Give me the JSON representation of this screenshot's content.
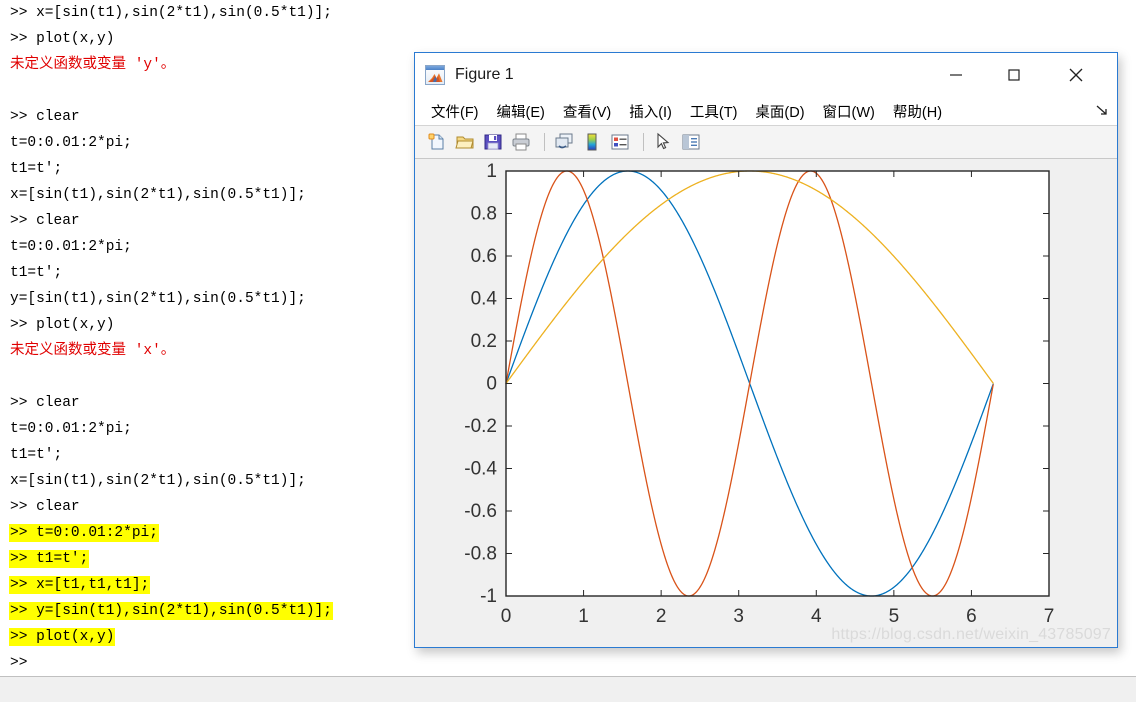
{
  "console": {
    "lines": [
      {
        "text": ">> x=[sin(t1),sin(2*t1),sin(0.5*t1)];",
        "style": "normal",
        "highlight": false
      },
      {
        "text": ">> plot(x,y)",
        "style": "normal",
        "highlight": false
      },
      {
        "text": "未定义函数或变量 'y'。",
        "style": "error",
        "highlight": false
      },
      {
        "text": "",
        "style": "normal",
        "highlight": false
      },
      {
        "text": ">> clear",
        "style": "normal",
        "highlight": false
      },
      {
        "text": "t=0:0.01:2*pi;",
        "style": "normal",
        "highlight": false
      },
      {
        "text": "t1=t';",
        "style": "normal",
        "highlight": false
      },
      {
        "text": "x=[sin(t1),sin(2*t1),sin(0.5*t1)];",
        "style": "normal",
        "highlight": false
      },
      {
        "text": ">> clear",
        "style": "normal",
        "highlight": false
      },
      {
        "text": "t=0:0.01:2*pi;",
        "style": "normal",
        "highlight": false
      },
      {
        "text": "t1=t';",
        "style": "normal",
        "highlight": false
      },
      {
        "text": "y=[sin(t1),sin(2*t1),sin(0.5*t1)];",
        "style": "normal",
        "highlight": false
      },
      {
        "text": ">> plot(x,y)",
        "style": "normal",
        "highlight": false
      },
      {
        "text": "未定义函数或变量 'x'。",
        "style": "error",
        "highlight": false
      },
      {
        "text": "",
        "style": "normal",
        "highlight": false
      },
      {
        "text": ">> clear",
        "style": "normal",
        "highlight": false
      },
      {
        "text": "t=0:0.01:2*pi;",
        "style": "normal",
        "highlight": false
      },
      {
        "text": "t1=t';",
        "style": "normal",
        "highlight": false
      },
      {
        "text": "x=[sin(t1),sin(2*t1),sin(0.5*t1)];",
        "style": "normal",
        "highlight": false
      },
      {
        "text": ">> clear",
        "style": "normal",
        "highlight": false
      },
      {
        "text": ">> t=0:0.01:2*pi;",
        "style": "normal",
        "highlight": true
      },
      {
        "text": ">> t1=t';",
        "style": "normal",
        "highlight": true
      },
      {
        "text": ">> x=[t1,t1,t1];",
        "style": "normal",
        "highlight": true
      },
      {
        "text": ">> y=[sin(t1),sin(2*t1),sin(0.5*t1)];",
        "style": "normal",
        "highlight": true
      },
      {
        "text": ">> plot(x,y)",
        "style": "normal",
        "highlight": true
      },
      {
        "text": ">>",
        "style": "normal",
        "highlight": false
      }
    ],
    "prompt": ">>",
    "error_color": "#e00000",
    "highlight_color": "#ffff00"
  },
  "figure_window": {
    "title": "Figure 1",
    "icon": "matlab-figure-icon",
    "window_controls": [
      {
        "name": "minimize",
        "glyph": "—"
      },
      {
        "name": "maximize",
        "glyph": "□"
      },
      {
        "name": "close",
        "glyph": "✕"
      }
    ],
    "menu": [
      {
        "label": "文件(F)",
        "name": "file"
      },
      {
        "label": "编辑(E)",
        "name": "edit"
      },
      {
        "label": "查看(V)",
        "name": "view"
      },
      {
        "label": "插入(I)",
        "name": "insert"
      },
      {
        "label": "工具(T)",
        "name": "tools"
      },
      {
        "label": "桌面(D)",
        "name": "desktop"
      },
      {
        "label": "窗口(W)",
        "name": "window"
      },
      {
        "label": "帮助(H)",
        "name": "help"
      }
    ],
    "menu_overflow": "overflow-arrow-icon",
    "toolbar": [
      {
        "name": "new-figure-icon",
        "title": "新建图窗"
      },
      {
        "name": "open-file-icon",
        "title": "打开文件"
      },
      {
        "name": "save-figure-icon",
        "title": "保存图窗"
      },
      {
        "name": "print-figure-icon",
        "title": "打印图窗"
      },
      {
        "name": "link-plot-icon",
        "title": "链接绘图"
      },
      {
        "name": "colorbar-icon",
        "title": "插入颜色栏"
      },
      {
        "name": "legend-icon",
        "title": "插入图例"
      },
      {
        "name": "edit-plot-pointer-icon",
        "title": "编辑绘图"
      },
      {
        "name": "property-inspector-icon",
        "title": "打开属性检查器"
      }
    ],
    "watermark": "https://blog.csdn.net/weixin_43785097"
  },
  "chart_data": {
    "type": "line",
    "title": "",
    "xlabel": "",
    "ylabel": "",
    "xlim": [
      0,
      7
    ],
    "ylim": [
      -1,
      1
    ],
    "xticks": [
      0,
      1,
      2,
      3,
      4,
      5,
      6,
      7
    ],
    "xticklabels": [
      "0",
      "1",
      "2",
      "3",
      "4",
      "5",
      "6",
      "7"
    ],
    "yticks": [
      -1,
      -0.8,
      -0.6,
      -0.4,
      -0.2,
      0,
      0.2,
      0.4,
      0.6,
      0.8,
      1
    ],
    "yticklabels": [
      "-1",
      "-0.8",
      "-0.6",
      "-0.4",
      "-0.2",
      "0",
      "0.2",
      "0.4",
      "0.6",
      "0.8",
      "1"
    ],
    "grid": false,
    "legend": null,
    "x_domain": [
      0,
      6.283185307179586
    ],
    "x_step": 0.01,
    "series": [
      {
        "name": "sin(t1)",
        "color": "#0072BD",
        "formula": "sin",
        "freq": 1.0
      },
      {
        "name": "sin(2*t1)",
        "color": "#D95319",
        "formula": "sin",
        "freq": 2.0
      },
      {
        "name": "sin(0.5*t1)",
        "color": "#EDB120",
        "formula": "sin",
        "freq": 0.5
      }
    ],
    "axes_box_color": "#262626",
    "background": "#ffffff",
    "figure_background": "#f0f0f0"
  }
}
